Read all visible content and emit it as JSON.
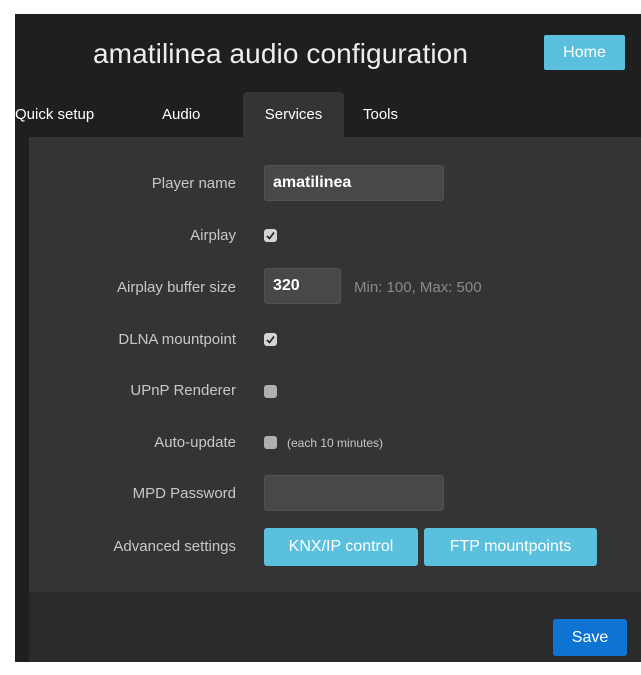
{
  "header": {
    "title": "amatilinea audio configuration",
    "home_label": "Home"
  },
  "tabs": [
    {
      "label": "Quick setup",
      "active": false
    },
    {
      "label": "Audio",
      "active": false
    },
    {
      "label": "Services",
      "active": true
    },
    {
      "label": "Tools",
      "active": false
    }
  ],
  "form": {
    "player_name": {
      "label": "Player name",
      "value": "amatilinea"
    },
    "airplay": {
      "label": "Airplay",
      "checked": true
    },
    "airplay_buffer": {
      "label": "Airplay buffer size",
      "value": "320",
      "hint": "Min: 100, Max: 500"
    },
    "dlna": {
      "label": "DLNA mountpoint",
      "checked": true
    },
    "upnp": {
      "label": "UPnP Renderer",
      "checked": false
    },
    "auto_update": {
      "label": "Auto-update",
      "checked": false,
      "hint": "(each 10 minutes)"
    },
    "mpd_password": {
      "label": "MPD Password",
      "value": ""
    },
    "advanced": {
      "label": "Advanced settings",
      "knx_label": "KNX/IP control",
      "ftp_label": "FTP mountpoints"
    }
  },
  "footer": {
    "save_label": "Save"
  },
  "colors": {
    "accent_info": "#5bc0de",
    "accent_primary": "#0d74d4",
    "background": "#1f1f1f",
    "panel": "#343434"
  }
}
